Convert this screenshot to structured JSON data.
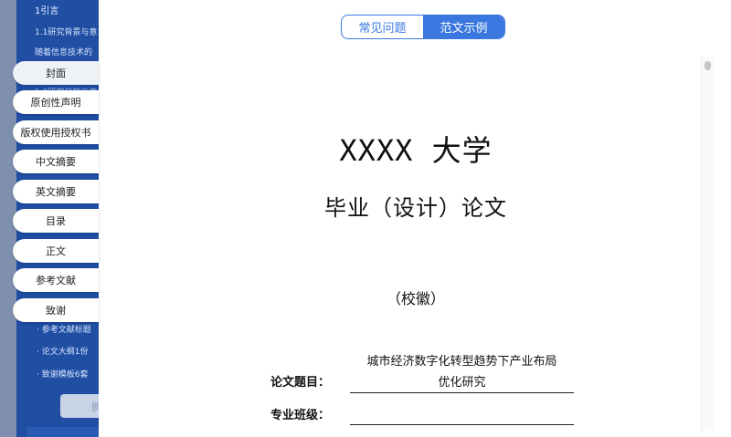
{
  "background_panel": {
    "heading": "1引言",
    "subheading": "1.1研究背景与意",
    "paragraph": "随着信息技术的",
    "faded_line": "1.2研究目的与意",
    "bottom_items": [
      "· 参考文献标题",
      "· 论文大纲1份",
      "· 致谢模板6套"
    ],
    "button_fragment": "购"
  },
  "nav": {
    "items": [
      {
        "label": "封面",
        "active": true
      },
      {
        "label": "原创性声明",
        "active": false
      },
      {
        "label": "版权使用授权书",
        "active": false
      },
      {
        "label": "中文摘要",
        "active": false
      },
      {
        "label": "英文摘要",
        "active": false
      },
      {
        "label": "目录",
        "active": false
      },
      {
        "label": "正文",
        "active": false
      },
      {
        "label": "参考文献",
        "active": false
      },
      {
        "label": "致谢",
        "active": false
      }
    ]
  },
  "tabs": [
    {
      "label": "常见问题",
      "selected": false
    },
    {
      "label": "范文示例",
      "selected": true
    }
  ],
  "document": {
    "university": "XXXX 大学",
    "thesis_type": "毕业（设计）论文",
    "emblem": "（校徽）",
    "fields": {
      "title_label": "论文题目：",
      "title_value_line1": "城市经济数字化转型趋势下产业布局",
      "title_value_line2": "优化研究",
      "class_label": "专业班级："
    }
  },
  "colors": {
    "accent": "#3a78e0",
    "panel_blue": "#1f4ea3"
  }
}
